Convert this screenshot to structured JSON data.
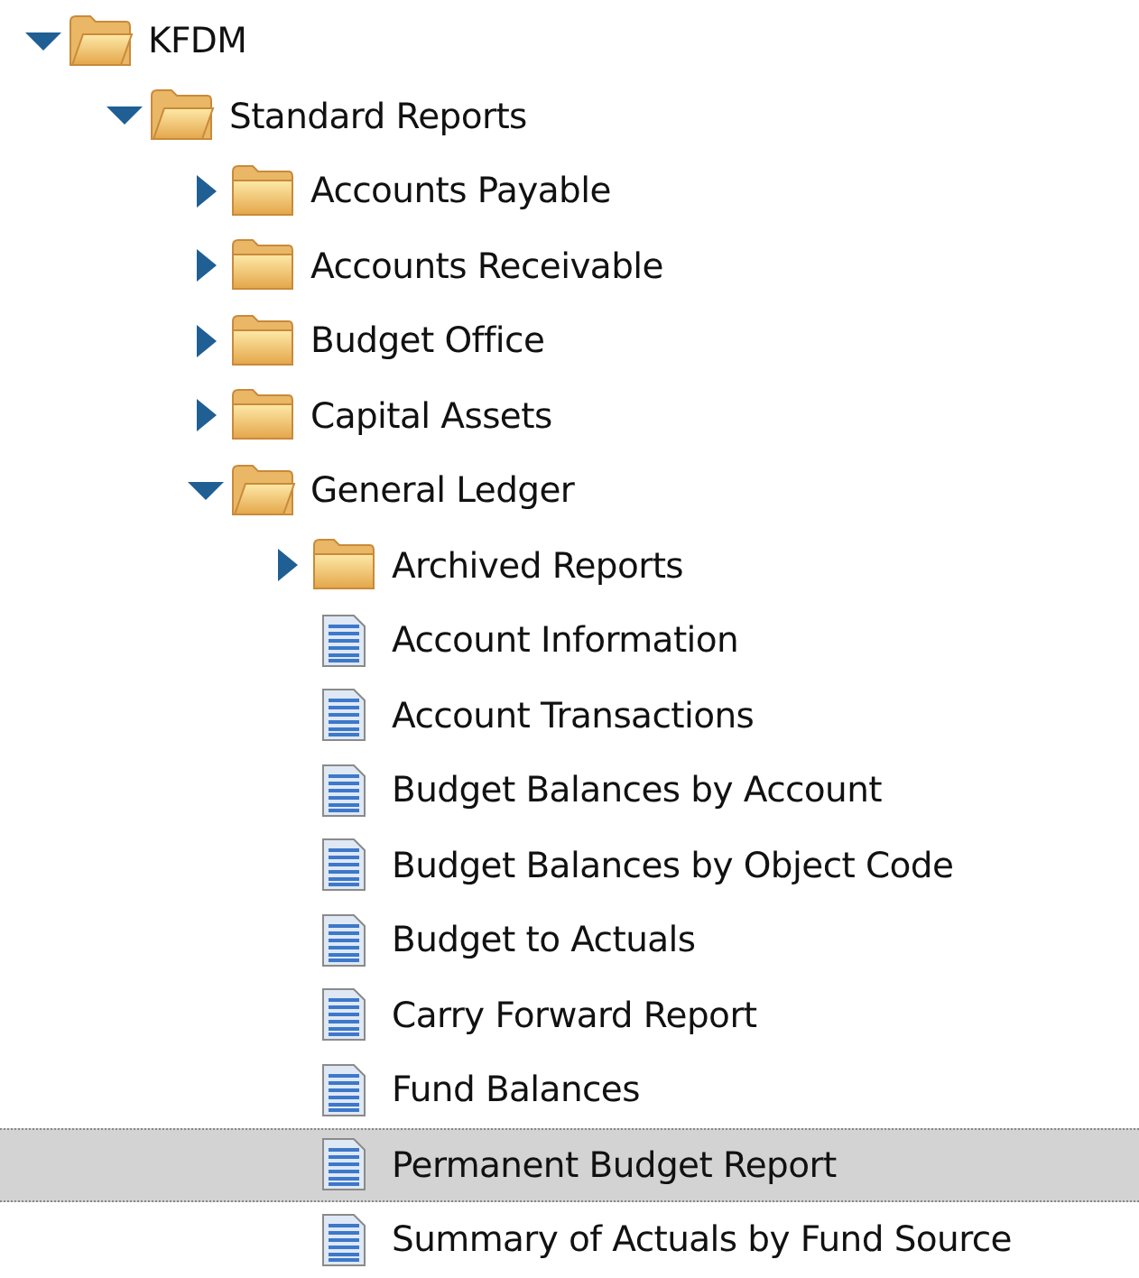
{
  "tree": [
    {
      "kind": "folder",
      "label": "KFDM",
      "expanded": true,
      "selected": false,
      "children": [
        {
          "kind": "folder",
          "label": "Standard Reports",
          "expanded": true,
          "selected": false,
          "children": [
            {
              "kind": "folder",
              "label": "Accounts Payable",
              "expanded": false,
              "selected": false
            },
            {
              "kind": "folder",
              "label": "Accounts Receivable",
              "expanded": false,
              "selected": false
            },
            {
              "kind": "folder",
              "label": "Budget Office",
              "expanded": false,
              "selected": false
            },
            {
              "kind": "folder",
              "label": "Capital Assets",
              "expanded": false,
              "selected": false
            },
            {
              "kind": "folder",
              "label": "General Ledger",
              "expanded": true,
              "selected": false,
              "children": [
                {
                  "kind": "folder",
                  "label": "Archived Reports",
                  "expanded": false,
                  "selected": false
                },
                {
                  "kind": "report",
                  "label": "Account Information",
                  "selected": false
                },
                {
                  "kind": "report",
                  "label": "Account Transactions",
                  "selected": false
                },
                {
                  "kind": "report",
                  "label": "Budget Balances by Account",
                  "selected": false
                },
                {
                  "kind": "report",
                  "label": "Budget Balances by Object Code",
                  "selected": false
                },
                {
                  "kind": "report",
                  "label": "Budget to Actuals",
                  "selected": false
                },
                {
                  "kind": "report",
                  "label": "Carry Forward Report",
                  "selected": false
                },
                {
                  "kind": "report",
                  "label": "Fund Balances",
                  "selected": false
                },
                {
                  "kind": "report",
                  "label": "Permanent Budget Report",
                  "selected": true
                },
                {
                  "kind": "report",
                  "label": "Summary of Actuals by Fund Source",
                  "selected": false
                }
              ]
            }
          ]
        }
      ]
    }
  ]
}
